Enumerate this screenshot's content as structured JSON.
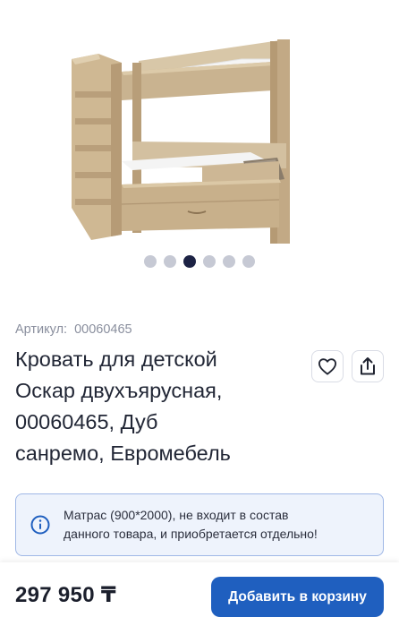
{
  "gallery": {
    "image_alt": "bunk-bed-photo",
    "slide_count": 6,
    "active_index": 2
  },
  "product": {
    "sku_label": "Артикул:",
    "sku_value": "00060465",
    "title_lines": [
      "Кровать для детской",
      "Оскар двухъярусная,",
      "00060465, Дуб",
      "санремо, Евромебель"
    ]
  },
  "actions": {
    "favorite_icon": "heart-icon",
    "share_icon": "share-icon"
  },
  "notice": {
    "icon": "info-icon",
    "lines": [
      "Матрас (900*2000), не входит в состав",
      "данного товара, и приобретается отдельно!"
    ]
  },
  "purchase": {
    "price": "297 950 ₸",
    "add_to_cart_label": "Добавить в корзину"
  },
  "colors": {
    "accent": "#1f5fbf",
    "active_dot": "#1c2244",
    "notice_border": "#9fb7e6",
    "notice_bg": "#eef3fc"
  }
}
